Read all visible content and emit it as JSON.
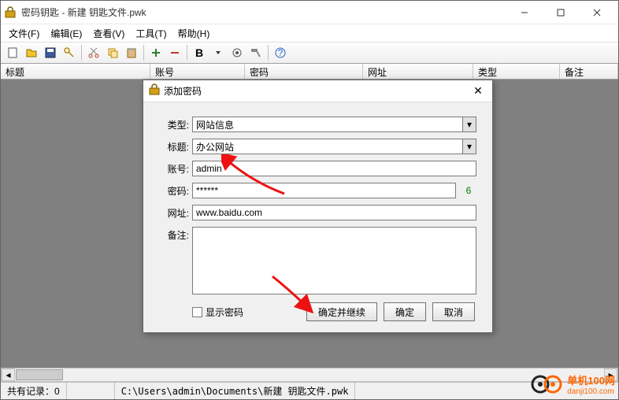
{
  "window": {
    "title": "密码钥匙 - 新建 钥匙文件.pwk"
  },
  "menu": {
    "file": "文件(F)",
    "edit": "编辑(E)",
    "view": "查看(V)",
    "tools": "工具(T)",
    "help": "帮助(H)"
  },
  "columns": {
    "title": "标题",
    "account": "账号",
    "password": "密码",
    "url": "网址",
    "type": "类型",
    "remark": "备注"
  },
  "status": {
    "records_label": "共有记录：",
    "records_count": "0",
    "path": "C:\\Users\\admin\\Documents\\新建 钥匙文件.pwk"
  },
  "dialog": {
    "title": "添加密码",
    "labels": {
      "type": "类型:",
      "title": "标题:",
      "account": "账号:",
      "password": "密码:",
      "url": "网址:",
      "remark": "备注:"
    },
    "values": {
      "type": "网站信息",
      "title": "办公网站",
      "account": "admin",
      "password": "******",
      "password_len": "6",
      "url": "www.baidu.com",
      "remark": ""
    },
    "show_password": "显示密码",
    "btn_ok_continue": "确定并继续",
    "btn_ok": "确定",
    "btn_cancel": "取消"
  },
  "watermark": {
    "name": "单机100网",
    "url": "danji100.com"
  }
}
